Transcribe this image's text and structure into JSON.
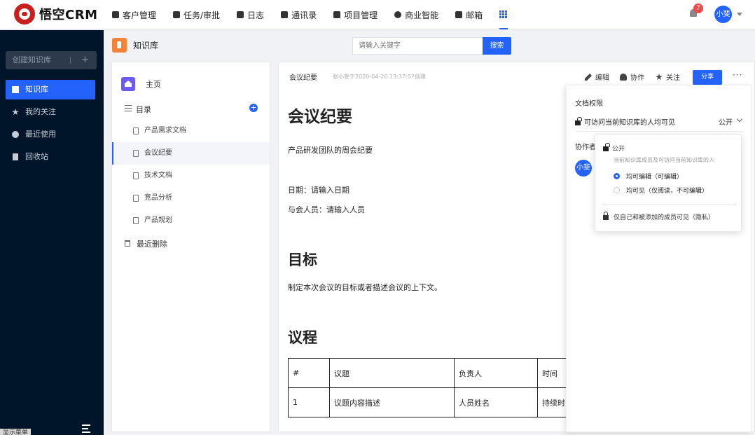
{
  "app": {
    "logo_text": "悟空CRM"
  },
  "nav": {
    "items": [
      {
        "label": "客户管理",
        "icon": "customer-icon"
      },
      {
        "label": "任务/审批",
        "icon": "briefcase-icon"
      },
      {
        "label": "日志",
        "icon": "log-icon"
      },
      {
        "label": "通讯录",
        "icon": "contacts-icon"
      },
      {
        "label": "项目管理",
        "icon": "project-icon"
      },
      {
        "label": "商业智能",
        "icon": "bi-icon"
      },
      {
        "label": "邮箱",
        "icon": "mail-icon"
      }
    ],
    "apps_icon": "grid-icon",
    "notification_count": "7",
    "user": "小斐"
  },
  "sidebar": {
    "create_label": "创建知识库",
    "create_plus": "+",
    "items": [
      {
        "label": "知识库",
        "icon": "book-icon",
        "active": true
      },
      {
        "label": "我的关注",
        "icon": "star-icon",
        "active": false
      },
      {
        "label": "最近使用",
        "icon": "clock-icon",
        "active": false
      },
      {
        "label": "回收站",
        "icon": "trash-icon",
        "active": false
      }
    ],
    "hint": "显示菜单"
  },
  "header": {
    "title": "知识库",
    "search_placeholder": "请输入关键字",
    "search_button": "搜索"
  },
  "catalog": {
    "home": "主页",
    "toc": "目录",
    "add": "+",
    "docs": [
      "产品需求文档",
      "会议纪要",
      "技术文档",
      "竞品分析",
      "产品规划"
    ],
    "active_doc": "会议纪要",
    "recently_deleted": "最近删除"
  },
  "doc": {
    "head_title": "会议纪要",
    "meta": "张小斐于2020-04-20 13:37:57创建",
    "actions": {
      "edit": "编辑",
      "collab": "协作",
      "follow": "关注",
      "share": "分享",
      "more": "···"
    },
    "title": "会议纪要",
    "intro": "产品研发团队的周会纪要",
    "date": "日期：请输入日期",
    "attendees": "与会人员：请输入人员",
    "goal_heading": "目标",
    "goal_text": "制定本次会议的目标或者描述会议的上下文。",
    "agenda_heading": "议程",
    "agenda_table": {
      "headers": [
        "#",
        "议题",
        "负责人",
        "时间"
      ],
      "rows": [
        [
          "1",
          "议题内容描述",
          "人员姓名",
          "持续时"
        ]
      ]
    }
  },
  "permission": {
    "title": "文档权限",
    "current": "可访问当前知识库的人均可见",
    "mode": "公开",
    "collab_title": "协作者",
    "collab_avatar": "小斐",
    "dropdown": {
      "public_label": "公开",
      "public_desc": "当前知识库成员及可访问当前知识库的人",
      "options": [
        {
          "label": "均可编辑（可编辑）",
          "selected": true
        },
        {
          "label": "均可见（仅阅读，不可编辑）",
          "selected": false
        }
      ],
      "private_label": "仅自己和被添加的成员可见（隐私）"
    }
  },
  "colors": {
    "accent": "#2362fb",
    "sidebar_bg": "#001529",
    "logo_red": "#c8201f",
    "kb_orange": "#f5843b"
  }
}
